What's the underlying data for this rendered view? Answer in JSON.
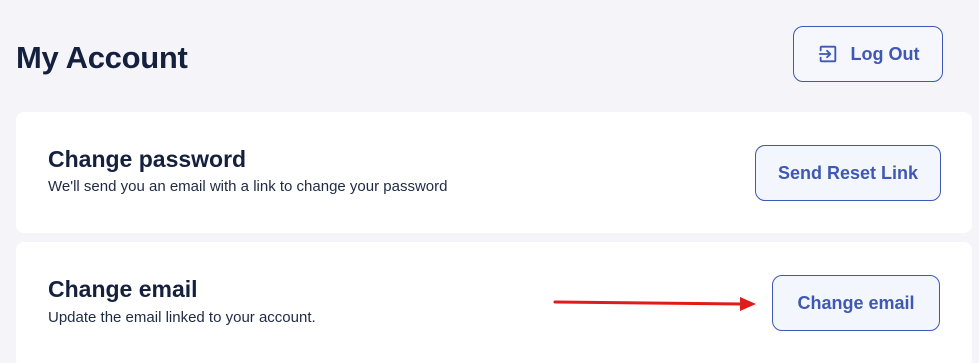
{
  "header": {
    "title": "My Account",
    "logout_label": "Log Out",
    "logout_icon": "logout-icon"
  },
  "password_section": {
    "title": "Change password",
    "description": "We'll send you an email with a link to change your password",
    "button_label": "Send Reset Link"
  },
  "email_section": {
    "title": "Change email",
    "description": "Update the email linked to your account.",
    "button_label": "Change email"
  },
  "annotation": {
    "type": "arrow",
    "color": "#e01b1b"
  },
  "colors": {
    "background": "#f4f4f9",
    "card": "#ffffff",
    "accent": "#3e58b4",
    "text": "#14203d"
  }
}
